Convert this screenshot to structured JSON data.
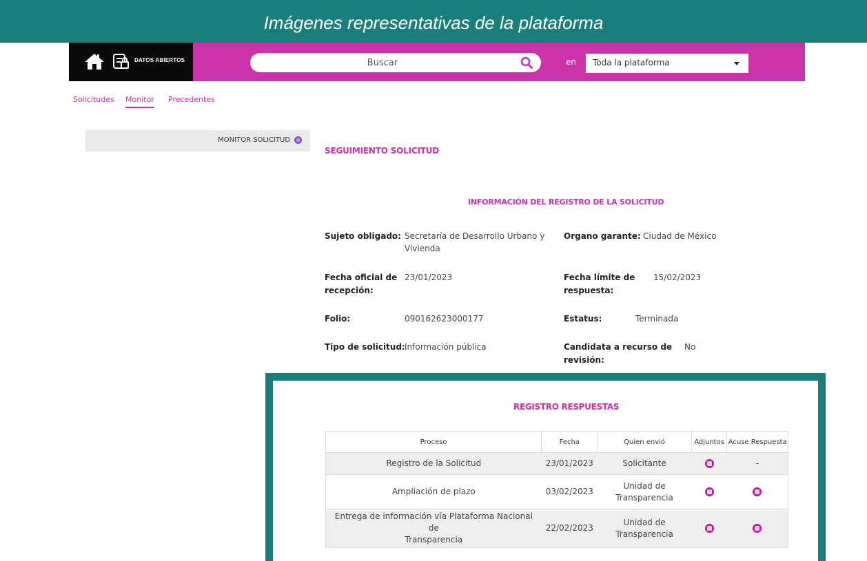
{
  "banner": {
    "title": "Imágenes representativas de la plataforma"
  },
  "header": {
    "brand_label": "DATOS ABIERTOS",
    "search_placeholder": "Buscar",
    "scope_prefix": "en",
    "scope_value": "Toda la plataforma",
    "colors": {
      "accent": "#cc33aa",
      "brand_bg": "#0a0a0a",
      "frame": "#1a7f7b"
    }
  },
  "tabs": [
    {
      "label": "Solicitudes",
      "active": false
    },
    {
      "label": "Monitor",
      "active": true
    },
    {
      "label": "Precedentes",
      "active": false
    }
  ],
  "sidebar": {
    "item_label": "MONITOR SOLICITUD"
  },
  "main": {
    "section_title": "SEGUIMIENTO SOLICITUD",
    "info_title": "INFORMACIÓN DEL REGISTRO DE LA SOLICITUD",
    "fields": {
      "sujeto_label": "Sujeto obligado:",
      "sujeto_value_1": "Secretaría de Desarrollo Urbano y",
      "sujeto_value_2": "Vivienda",
      "organo_label": "Organo garante:",
      "organo_value": "Ciudad de México",
      "fecha_oficial_label_1": "Fecha oficial de",
      "fecha_oficial_label_2": "recepción:",
      "fecha_oficial_value": "23/01/2023",
      "fecha_limite_label_1": "Fecha límite de",
      "fecha_limite_label_2": "respuesta:",
      "fecha_limite_value": "15/02/2023",
      "folio_label": "Folio:",
      "folio_value": "090162623000177",
      "estatus_label": "Estatus:",
      "estatus_value": "Terminada",
      "tipo_label": "Tipo de solicitud:",
      "tipo_value": "Información pública",
      "candidata_label_1": "Candidata a recurso de",
      "candidata_label_2": "revisión:",
      "candidata_value": "No"
    }
  },
  "responses": {
    "title": "REGISTRO RESPUESTAS",
    "columns": [
      "Proceso",
      "Fecha",
      "Quien envió",
      "Adjuntos",
      "Acuse Respuesta"
    ],
    "rows": [
      {
        "proceso_1": "Registro de la Solicitud",
        "proceso_2": "",
        "fecha": "23/01/2023",
        "quien_1": "Solicitante",
        "quien_2": "",
        "acuse": "-"
      },
      {
        "proceso_1": "Ampliación de plazo",
        "proceso_2": "",
        "fecha": "03/02/2023",
        "quien_1": "Unidad de",
        "quien_2": "Transparencia",
        "acuse": ""
      },
      {
        "proceso_1": "Entrega de información vía Plataforma Nacional de",
        "proceso_2": "Transparencia",
        "fecha": "22/02/2023",
        "quien_1": "Unidad de",
        "quien_2": "Transparencia",
        "acuse": ""
      }
    ]
  }
}
